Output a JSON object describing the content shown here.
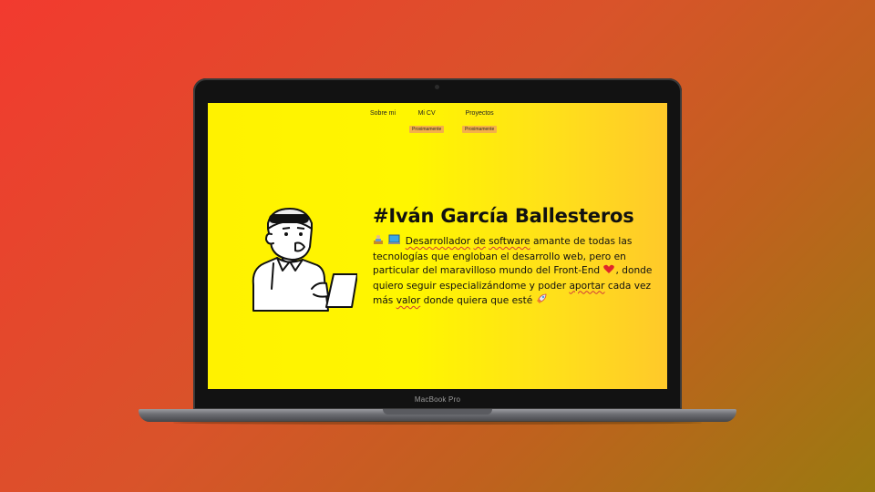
{
  "device": {
    "brand_label": "MacBook Pro"
  },
  "nav": {
    "items": [
      {
        "label": "Sobre mi",
        "badge": ""
      },
      {
        "label": "Mi CV",
        "badge": "Proximamente"
      },
      {
        "label": "Proyectos",
        "badge": "Proximamente"
      }
    ]
  },
  "hero": {
    "title": "#Iván García Ballesteros",
    "description": {
      "w1": "Desarrollador",
      "w2": "de",
      "w3": "software",
      "t1": " amante de todas las tecnologías que engloban el desarrollo web, pero en particular del maravilloso mundo del Front-End ",
      "t2": ", donde quiero seguir especializándome y poder ",
      "w4": "aportar",
      "t3": " cada vez más ",
      "w5": "valor",
      "t4": " donde quiera que esté "
    },
    "icons": [
      "person-at-computer-icon",
      "laptop-icon",
      "heart-icon",
      "rocket-icon"
    ]
  },
  "colors": {
    "accent_yellow": "#fff200",
    "badge_orange": "#f4b04a",
    "background_red": "#f23a2f",
    "heart_red": "#e0262a"
  }
}
